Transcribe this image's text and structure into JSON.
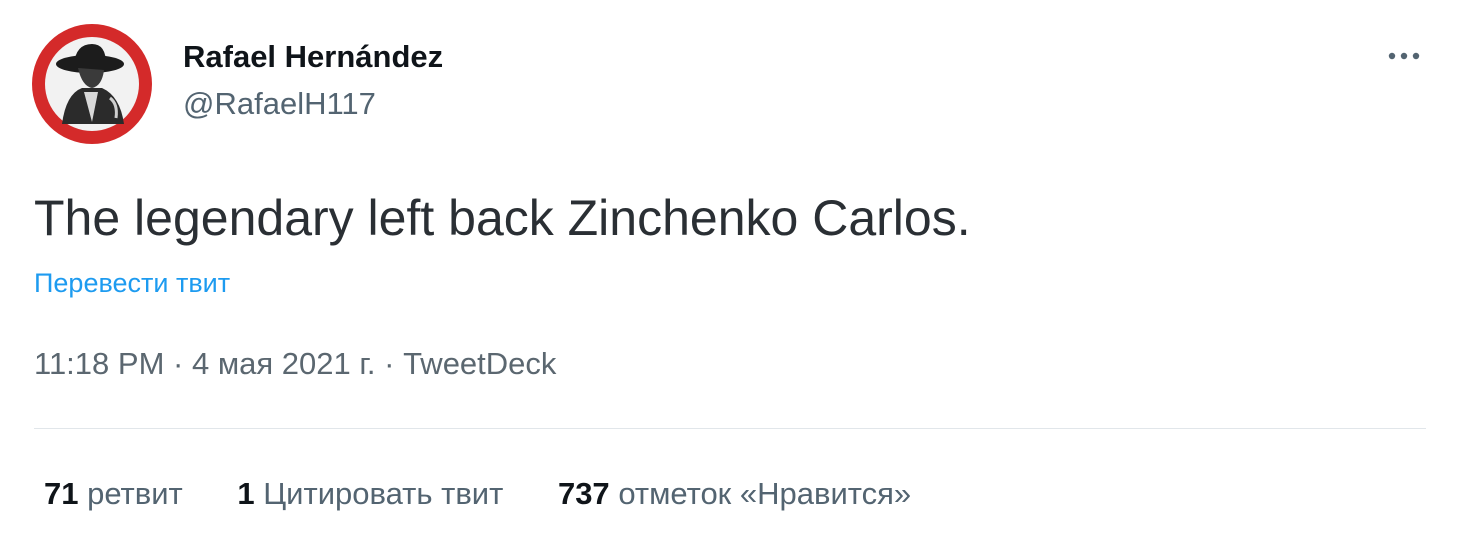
{
  "author": {
    "display_name": "Rafael Hernández",
    "handle": "@RafaelH117"
  },
  "avatar": {
    "icon": "avatar-wide-brim-hat-figure",
    "ring_color": "#d42a2a"
  },
  "more_menu": {
    "icon": "more-dots-icon"
  },
  "tweet": {
    "text": "The legendary left back Zinchenko Carlos.",
    "translate_label": "Перевести твит",
    "time": "11:18 PM",
    "separator": "·",
    "date": "4 мая 2021 г.",
    "source": "TweetDeck"
  },
  "stats": {
    "retweets_count": "71",
    "retweets_label": "ретвит",
    "quotes_count": "1",
    "quotes_label": "Цитировать твит",
    "likes_count": "737",
    "likes_label": "отметок «Нравится»"
  },
  "colors": {
    "link": "#1d9bf0",
    "secondary_text": "#536471",
    "primary_text": "#0f1419"
  }
}
